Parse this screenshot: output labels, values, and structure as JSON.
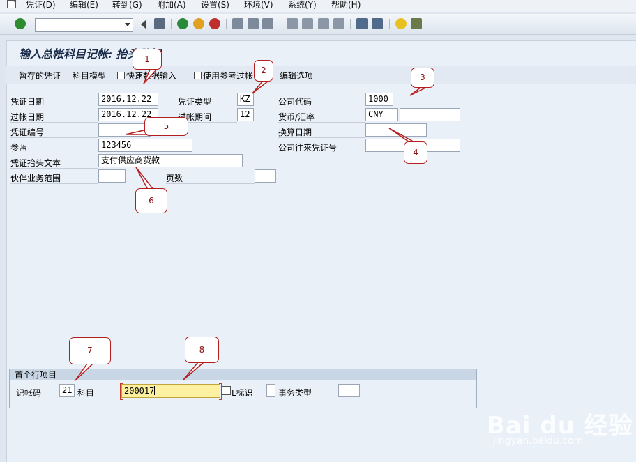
{
  "menubar": {
    "items": [
      "凭证(D)",
      "编辑(E)",
      "转到(G)",
      "附加(A)",
      "设置(S)",
      "环境(V)",
      "系统(Y)",
      "帮助(H)"
    ]
  },
  "toolbar": {
    "command_field": ""
  },
  "title": "输入总帐科目记帐: 抬头数据",
  "app_toolbar": {
    "parked_docs": "暂存的凭证",
    "account_model": "科目模型",
    "fast_entry": "快速数据输入",
    "post_with_ref": "使用参考过帐",
    "editing_options": "编辑选项"
  },
  "header": {
    "doc_date_label": "凭证日期",
    "doc_date": "2016.12.22",
    "doc_type_label": "凭证类型",
    "doc_type": "KZ",
    "company_code_label": "公司代码",
    "company_code": "1000",
    "posting_date_label": "过帐日期",
    "posting_date": "2016.12.22",
    "period_label": "过帐期间",
    "period": "12",
    "currency_label": "货币/汇率",
    "currency": "CNY",
    "rate": "",
    "doc_number_label": "凭证编号",
    "doc_number": "",
    "translation_date_label": "换算日期",
    "translation_date": "",
    "reference_label": "参照",
    "reference": "123456",
    "intercompany_label": "公司往来凭证号",
    "intercompany": "",
    "header_text_label": "凭证抬头文本",
    "header_text": "支付供应商货款",
    "trading_partner_label": "伙伴业务范围",
    "trading_partner": "",
    "pages_label": "页数",
    "pages": ""
  },
  "first_line": {
    "title": "首个行项目",
    "posting_key_label": "记帐码",
    "posting_key": "21",
    "account_label": "科目",
    "account": "200017",
    "sgl_label": "L标识",
    "sgl": "",
    "transaction_type_label": "事务类型",
    "transaction_type": ""
  },
  "callouts": [
    "1",
    "2",
    "3",
    "4",
    "5",
    "6",
    "7",
    "8"
  ],
  "watermark": {
    "logo": "Bai du 经验",
    "url": "jingyan.baidu.com"
  },
  "colors": {
    "background": "#dfe6ef",
    "active_field": "#fdf0a0",
    "callout_border": "#b41e1e"
  }
}
